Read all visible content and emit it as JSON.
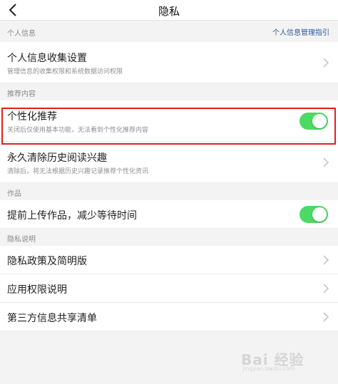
{
  "nav": {
    "title": "隐私",
    "back_icon": "chevron-left-icon"
  },
  "sections": {
    "personal_info": {
      "label": "个人信息",
      "link": "个人信息管理指引",
      "link_color": "#2d5a9e",
      "row": {
        "title": "个人信息收集设置",
        "subtitle": "管理信息的收集权限和系统数据访问权限"
      }
    },
    "recommend": {
      "label": "推荐内容",
      "personalized": {
        "title": "个性化推荐",
        "subtitle": "关闭后仅使用基本功能，无法看到个性化推荐内容",
        "toggle_on": true
      },
      "clear_history": {
        "title": "永久清除历史阅读兴趣",
        "subtitle": "清除后，将无法根据历史兴趣记录推荐个性化资讯"
      }
    },
    "works": {
      "label": "作品",
      "upload_early": {
        "title": "提前上传作品，减少等待时间",
        "toggle_on": true
      }
    },
    "privacy_notes": {
      "label": "隐私说明",
      "items": [
        {
          "title": "隐私政策及简明版"
        },
        {
          "title": "应用权限说明"
        },
        {
          "title": "第三方信息共享清单"
        }
      ]
    }
  },
  "colors": {
    "toggle_on": "#4cd964",
    "highlight": "#e0201b"
  },
  "watermark": {
    "text": "Bai 经验",
    "sub": "jingyan.baidu.com"
  }
}
